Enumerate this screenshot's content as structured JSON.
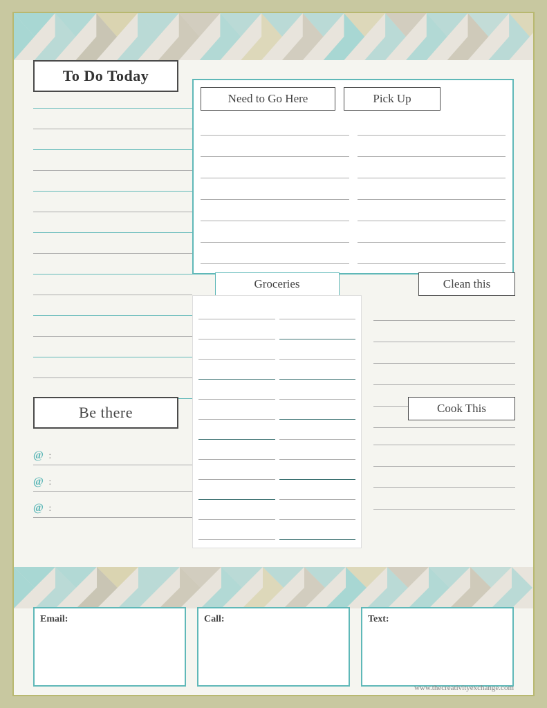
{
  "header": {
    "chevron_colors": [
      "#7ecece",
      "#b0b0a0",
      "#c8c890"
    ]
  },
  "todo_today": {
    "label": "To Do Today"
  },
  "be_there": {
    "label": "Be there"
  },
  "need_to_go": {
    "label": "Need to Go Here"
  },
  "pick_up": {
    "label": "Pick Up"
  },
  "groceries": {
    "label": "Groceries"
  },
  "clean_this": {
    "label": "Clean this"
  },
  "cook_this": {
    "label": "Cook This"
  },
  "contact": {
    "email_label": "Email:",
    "call_label": "Call:",
    "text_label": "Text:"
  },
  "schedule": {
    "rows": [
      "@ :",
      "@ :",
      "@ :"
    ]
  },
  "website": "www.thecreativityexchange.com"
}
